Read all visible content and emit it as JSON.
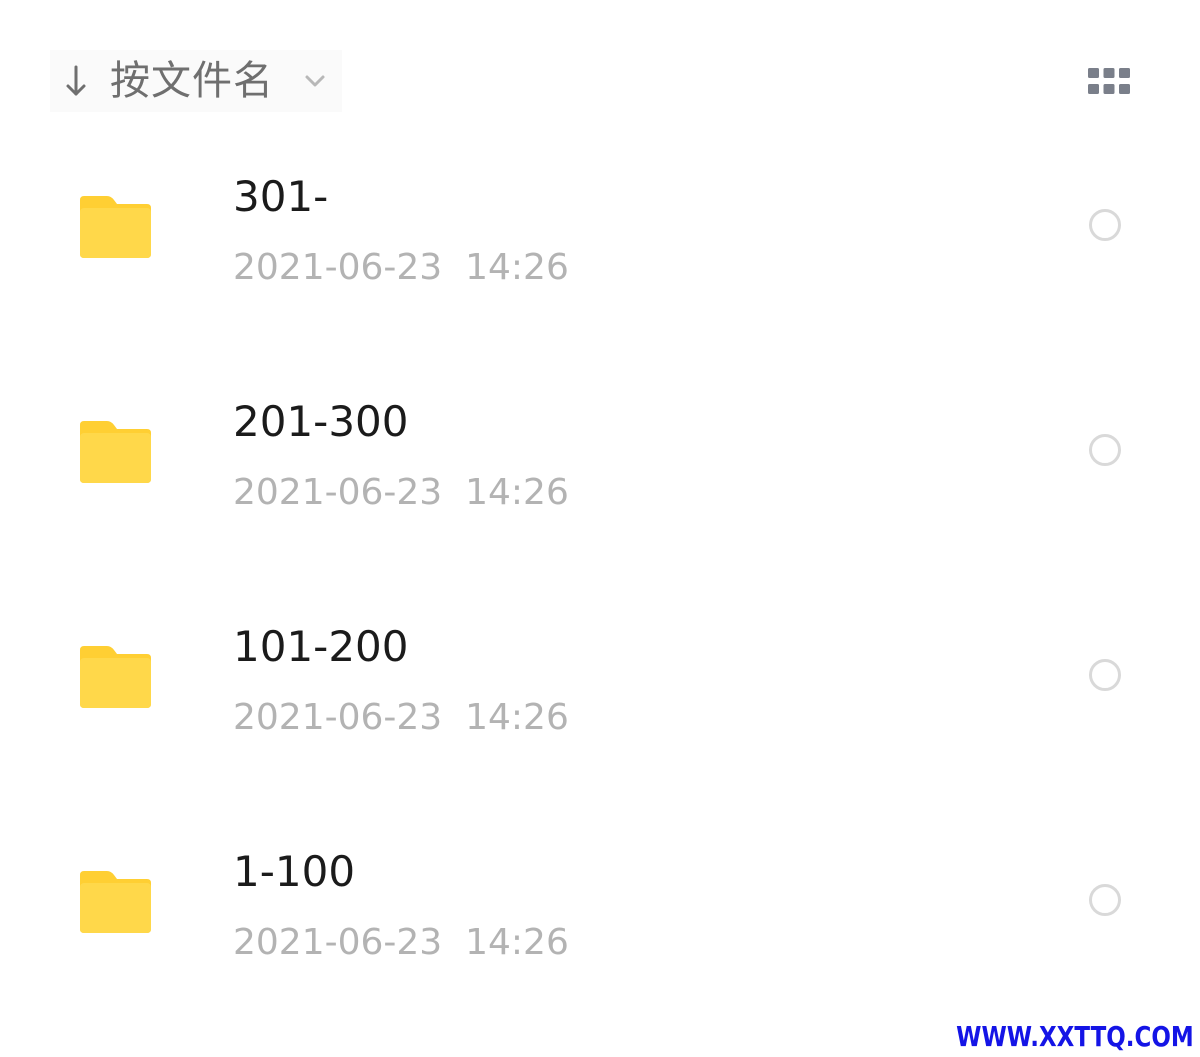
{
  "sort": {
    "label": "按文件名",
    "direction_icon": "arrow-down-icon",
    "dropdown_icon": "chevron-down-icon"
  },
  "view_toggle": {
    "icon": "grid-view-icon"
  },
  "files": [
    {
      "name": "301-",
      "date": "2021-06-23  14:26",
      "type_icon": "folder-icon"
    },
    {
      "name": "201-300",
      "date": "2021-06-23  14:26",
      "type_icon": "folder-icon"
    },
    {
      "name": "101-200",
      "date": "2021-06-23  14:26",
      "type_icon": "folder-icon"
    },
    {
      "name": "1-100",
      "date": "2021-06-23  14:26",
      "type_icon": "folder-icon"
    }
  ],
  "watermark": "WWW.XXTTQ.COM",
  "colors": {
    "folder": "#ffd84a",
    "folder_tab": "#ffcf33",
    "name_text": "#1b1b1b",
    "date_text": "#b3b3b3",
    "icon_gray": "#7a7f8a",
    "radio_border": "#d9d9d9",
    "watermark": "#1414e6"
  }
}
